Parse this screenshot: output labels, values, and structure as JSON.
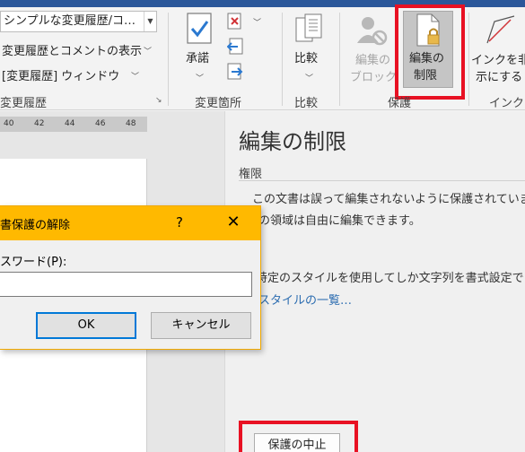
{
  "ribbon": {
    "tracking": {
      "markup_select_value": "シンプルな変更履歴/コ…",
      "show_markup": "変更履歴とコメントの表示",
      "reviewing_pane": "[変更履歴] ウィンドウ",
      "group_label": "変更履歴"
    },
    "changes": {
      "accept_label": "承諾",
      "group_label": "変更箇所"
    },
    "compare": {
      "compare_label": "比較",
      "group_label": "比較"
    },
    "protect": {
      "block_authors_line1": "編集の",
      "block_authors_line2": "ブロック",
      "restrict_editing_line1": "編集の",
      "restrict_editing_line2": "制限",
      "group_label": "保護"
    },
    "ink": {
      "hide_ink_line1": "インクを非",
      "hide_ink_line2": "示にする",
      "group_label": "インク"
    }
  },
  "ruler": {
    "ticks": [
      "40",
      "42",
      "44",
      "46",
      "48"
    ]
  },
  "pane": {
    "title": "編集の制限",
    "permissions_label": "権限",
    "line1": "この文書は誤って編集されないように保護されています",
    "line2": "の領域は自由に編集できます。",
    "line3": "特定のスタイルを使用してしか文字列を書式設定でき",
    "styles_link": "スタイルの一覧…",
    "stop_protection": "保護の中止"
  },
  "dialog": {
    "title": "書保護の解除",
    "help": "?",
    "close": "✕",
    "password_label": "スワード(P):",
    "password_value": "",
    "ok": "OK",
    "cancel": "キャンセル"
  },
  "colors": {
    "dialog_titlebar": "#ffb900",
    "highlight_box": "#e81123",
    "ok_focus": "#0078d7",
    "link": "#2b6cb0"
  }
}
